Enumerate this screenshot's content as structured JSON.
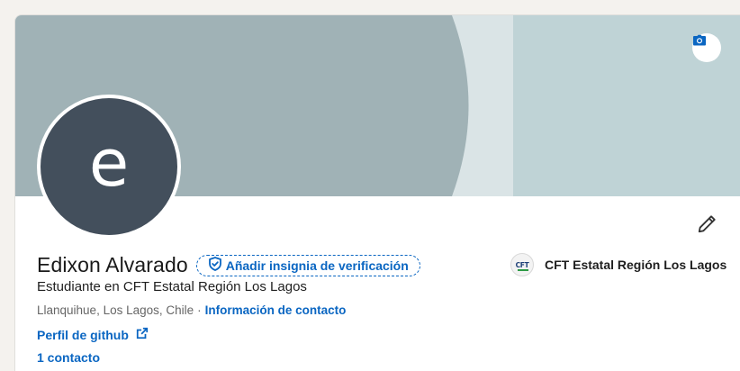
{
  "profile": {
    "avatar_letter": "e",
    "name": "Edixon Alvarado",
    "verify_label": "Añadir insignia de verificación",
    "headline": "Estudiante en CFT Estatal Región Los Lagos",
    "location": "Llanquihue, Los Lagos, Chile",
    "location_separator": "·",
    "contact_info_label": "Información de contacto",
    "github_label": "Perfil de github",
    "connections_label": "1 contacto"
  },
  "company": {
    "name": "CFT Estatal Región Los Lagos",
    "logo_text": "CFT"
  },
  "icons": {
    "banner_edit": "camera-icon",
    "intro_edit": "pencil-icon",
    "verify": "shield-check-icon",
    "external": "external-link-icon"
  },
  "colors": {
    "accent": "#0a66c2",
    "avatar_bg": "#434f5c",
    "banner_dark": "#a0b2b6",
    "banner_light": "#dae4e6",
    "banner_right": "#bfd3d6"
  }
}
